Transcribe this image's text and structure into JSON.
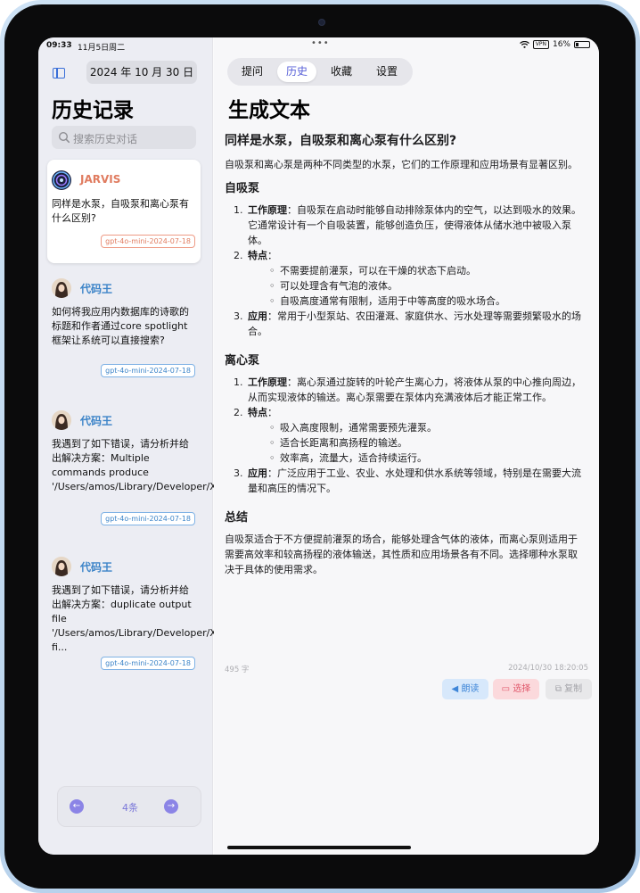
{
  "status_bar": {
    "time": "09:33",
    "date": "11月5日周二",
    "vpn": "VPN",
    "battery": "16%"
  },
  "sidebar": {
    "date": "2024 年 10 月 30 日",
    "title": "历史记录",
    "search_placeholder": "搜索历史对话",
    "items": [
      {
        "name": "JARVIS",
        "question": "同样是水泵，自吸泵和离心泵有什么区别?",
        "model": "gpt-4o-mini-2024-07-18",
        "active": true,
        "color": "#e07c60"
      },
      {
        "name": "代码王",
        "question": "如何将我应用内数据库的诗歌的标题和作者通过core spotlight框架让系统可以直接搜索?",
        "model": "gpt-4o-mini-2024-07-18",
        "active": false,
        "color": "#3c84c8"
      },
      {
        "name": "代码王",
        "question": "我遇到了如下错误，请分析并给出解决方案：Multiple commands produce '/Users/amos/Library/Developer/Xcode/D...",
        "model": "gpt-4o-mini-2024-07-18",
        "active": false,
        "color": "#3c84c8"
      },
      {
        "name": "代码王",
        "question": "我遇到了如下错误，请分析并给出解决方案：duplicate output file '/Users/amos/Library/Developer/Xcode/DerivedData/AmosPoem-fi...",
        "model": "gpt-4o-mini-2024-07-18",
        "active": false,
        "color": "#3c84c8"
      }
    ],
    "pager": {
      "count": "4条"
    }
  },
  "tabs": [
    "提问",
    "历史",
    "收藏",
    "设置"
  ],
  "active_tab": "历史",
  "main": {
    "title": "生成文本",
    "question": "同样是水泵，自吸泵和离心泵有什么区别?",
    "intro": "自吸泵和离心泵是两种不同类型的水泵，它们的工作原理和应用场景有显著区别。",
    "sections": [
      {
        "heading": "自吸泵",
        "principle_label": "工作原理",
        "principle": "：自吸泵在启动时能够自动排除泵体内的空气，以达到吸水的效果。它通常设计有一个自吸装置，能够创造负压，使得液体从储水池中被吸入泵体。",
        "features_label": "特点",
        "features": [
          "不需要提前灌泵，可以在干燥的状态下启动。",
          "可以处理含有气泡的液体。",
          "自吸高度通常有限制，适用于中等高度的吸水场合。"
        ],
        "application_label": "应用",
        "application": "：常用于小型泵站、农田灌溉、家庭供水、污水处理等需要频繁吸水的场合。"
      },
      {
        "heading": "离心泵",
        "principle_label": "工作原理",
        "principle": "：离心泵通过旋转的叶轮产生离心力，将液体从泵的中心推向周边，从而实现液体的输送。离心泵需要在泵体内充满液体后才能正常工作。",
        "features_label": "特点",
        "features": [
          "吸入高度限制，通常需要预先灌泵。",
          "适合长距离和高扬程的输送。",
          "效率高，流量大，适合持续运行。"
        ],
        "application_label": "应用",
        "application": "：广泛应用于工业、农业、水处理和供水系统等领域，特别是在需要大流量和高压的情况下。"
      }
    ],
    "summary_heading": "总结",
    "summary": "自吸泵适合于不方便提前灌泵的场合，能够处理含气体的液体，而离心泵则适用于需要高效率和较高扬程的液体输送，其性质和应用场景各有不同。选择哪种水泵取决于具体的使用需求。",
    "word_count": "495 字",
    "timestamp": "2024/10/30 18:20:05",
    "actions": {
      "read": "朗读",
      "select": "选择",
      "copy": "复制"
    }
  }
}
